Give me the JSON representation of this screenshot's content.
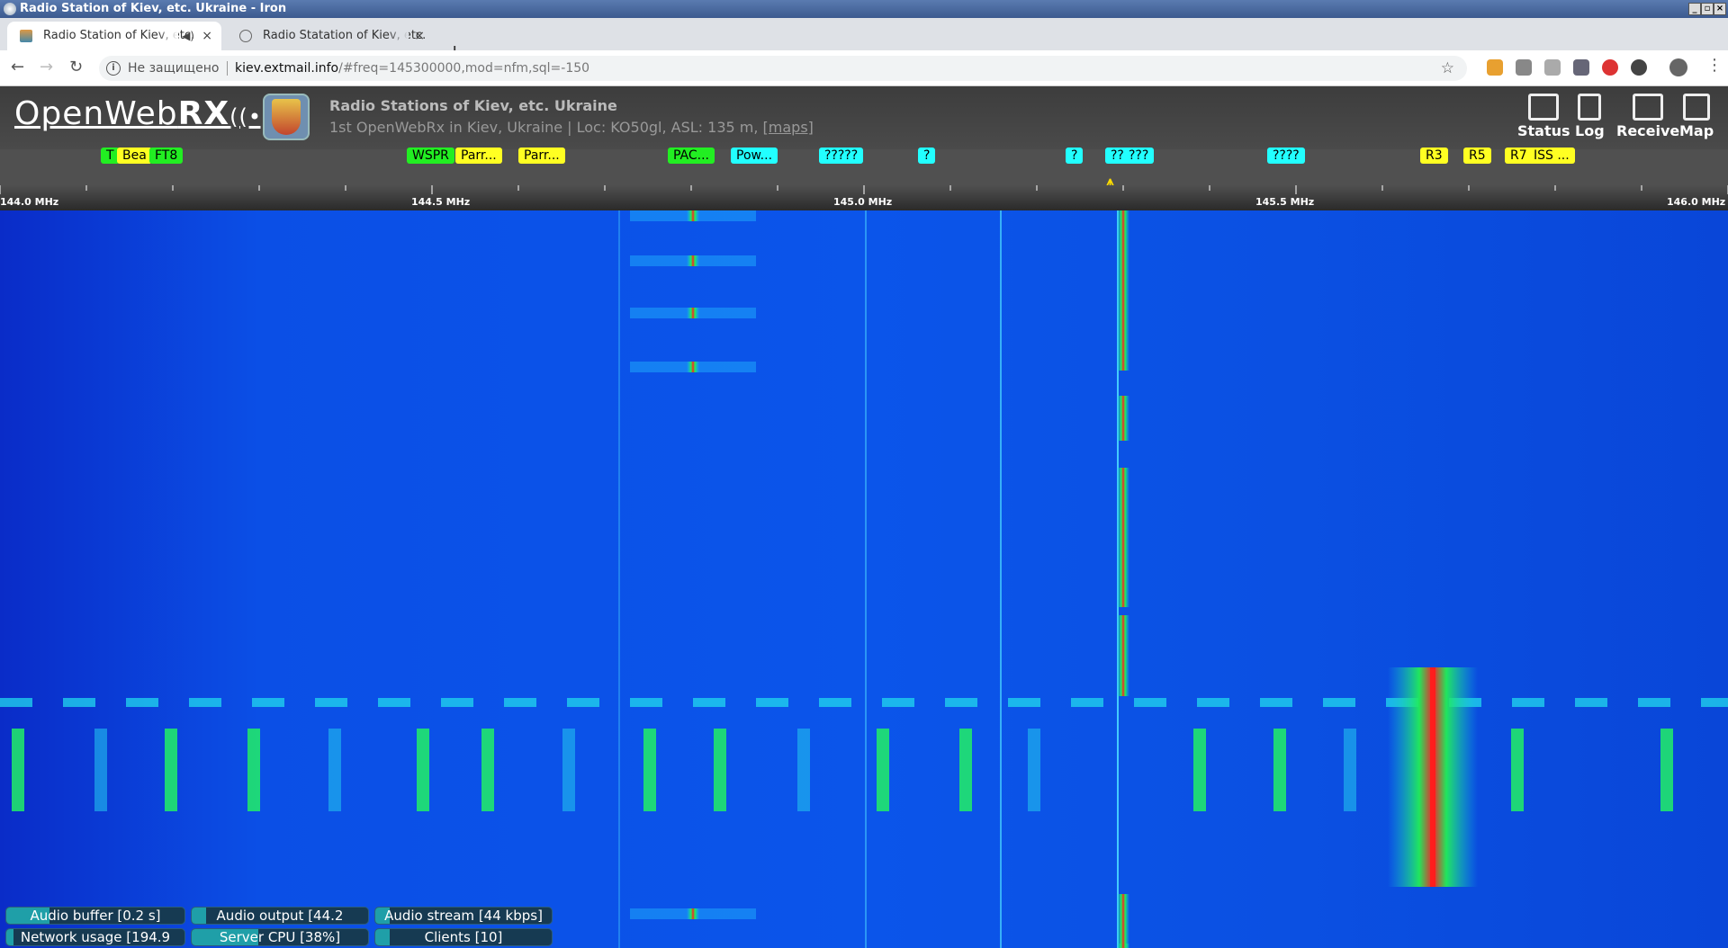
{
  "window": {
    "title": "Radio Station of Kiev, etc. Ukraine - Iron"
  },
  "tabs": [
    {
      "label": "Radio Station of Kiev, etc.",
      "active": true
    },
    {
      "label": "Radio Statation of Kiev, etc.",
      "active": false
    }
  ],
  "address_bar": {
    "security": "Не защищено",
    "host": "kiev.extmail.info",
    "path": "/#freq=145300000,mod=nfm,sql=-150"
  },
  "receiver": {
    "logo_light": "OpenWeb",
    "logo_bold": "RX",
    "logo_symbol": "((•))",
    "title": "Radio Stations of Kiev, etc. Ukraine",
    "description": "1st OpenWebRx in Kiev, Ukraine | Loc: KO50gl, ASL: 135 m, ",
    "maps_link": "[maps]"
  },
  "nav": [
    {
      "label": "Status",
      "icon": "status-icon"
    },
    {
      "label": "Log",
      "icon": "log-icon"
    },
    {
      "label": "Receive",
      "icon": "receive-icon"
    },
    {
      "label": "Map",
      "icon": "map-icon"
    }
  ],
  "bookmarks": [
    {
      "label": "T",
      "color": "green"
    },
    {
      "label": "Bea",
      "color": "yellow"
    },
    {
      "label": "FT8",
      "color": "green"
    },
    {
      "label": "WSPR",
      "color": "green"
    },
    {
      "label": "Parr...",
      "color": "yellow"
    },
    {
      "label": "Parr...",
      "color": "yellow"
    },
    {
      "label": "PAC...",
      "color": "green"
    },
    {
      "label": "Pow...",
      "color": "cyan"
    },
    {
      "label": "?????",
      "color": "cyan"
    },
    {
      "label": "?",
      "color": "cyan"
    },
    {
      "label": "?",
      "color": "cyan"
    },
    {
      "label": "??",
      "color": "cyan"
    },
    {
      "label": "???",
      "color": "cyan"
    },
    {
      "label": "????",
      "color": "cyan"
    },
    {
      "label": "R3",
      "color": "yellow"
    },
    {
      "label": "R5",
      "color": "yellow"
    },
    {
      "label": "R7",
      "color": "yellow"
    },
    {
      "label": "ISS ...",
      "color": "yellow"
    }
  ],
  "scale": {
    "labels": [
      "144.0 MHz",
      "144.5 MHz",
      "145.0 MHz",
      "145.5 MHz",
      "146.0 MHz"
    ],
    "start_mhz": 144.0,
    "end_mhz": 146.0,
    "tuned_mhz": 145.3
  },
  "status": {
    "audio_buffer": "Audio buffer [0.2 s]",
    "audio_output": "Audio output [44.2",
    "audio_stream": "Audio stream [44 kbps]",
    "network_usage": "Network usage [194.9",
    "server_cpu": "Server CPU [38%]",
    "clients": "Clients [10]",
    "server_cpu_pct": 38
  },
  "colors": {
    "bookmark_green": "#22ee22",
    "bookmark_yellow": "#ffff22",
    "bookmark_cyan": "#22ffff",
    "waterfall_base": "#0b52e8"
  }
}
